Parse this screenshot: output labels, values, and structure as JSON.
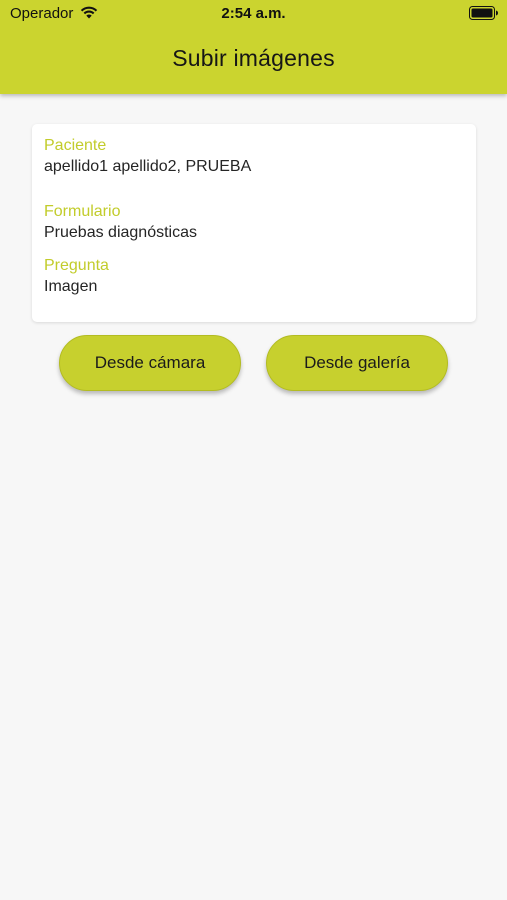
{
  "status_bar": {
    "carrier": "Operador",
    "time": "2:54 a.m.",
    "wifi_icon": "wifi-icon",
    "battery_icon": "battery-full-icon"
  },
  "header": {
    "title": "Subir imágenes"
  },
  "info": {
    "patient_label": "Paciente",
    "patient_value": "apellido1 apellido2, PRUEBA",
    "form_label": "Formulario",
    "form_value": "Pruebas diagnósticas",
    "question_label": "Pregunta",
    "question_value": "Imagen"
  },
  "actions": {
    "camera_label": "Desde cámara",
    "gallery_label": "Desde galería"
  },
  "colors": {
    "accent": "#cbd42f",
    "label": "#c2cc2b",
    "background": "#f7f7f7"
  }
}
